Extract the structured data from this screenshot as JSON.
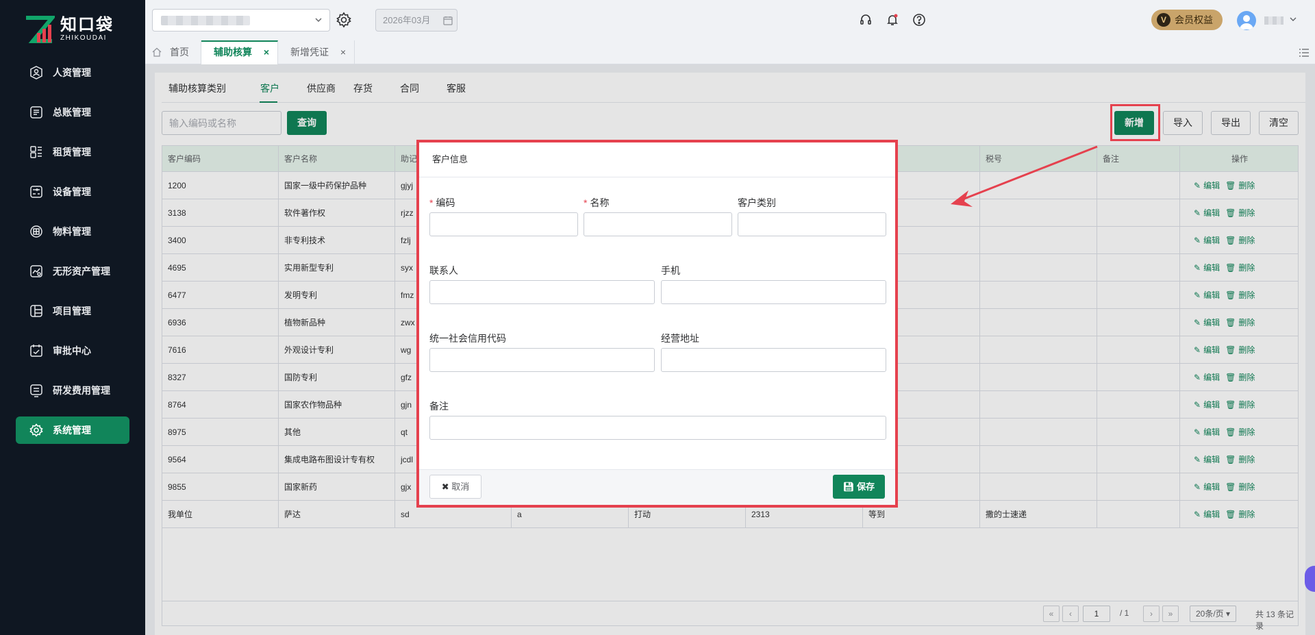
{
  "brand": {
    "name_cn": "知口袋",
    "name_en": "ZHIKOUDAI"
  },
  "colors": {
    "primary": "#11855a",
    "sidebar_bg": "#0f1722",
    "highlight": "#e5414e",
    "vip": "#c9a46a"
  },
  "sidebar": {
    "items": [
      {
        "label": "人资管理",
        "icon": "user-badge-icon"
      },
      {
        "label": "总账管理",
        "icon": "ledger-icon"
      },
      {
        "label": "租赁管理",
        "icon": "lease-icon"
      },
      {
        "label": "设备管理",
        "icon": "device-icon"
      },
      {
        "label": "物料管理",
        "icon": "material-icon"
      },
      {
        "label": "无形资产管理",
        "icon": "asset-chart-icon"
      },
      {
        "label": "项目管理",
        "icon": "project-icon"
      },
      {
        "label": "审批中心",
        "icon": "approval-icon"
      },
      {
        "label": "研发费用管理",
        "icon": "rnd-icon"
      },
      {
        "label": "系统管理",
        "icon": "gear-icon",
        "active": true
      }
    ]
  },
  "header": {
    "date": "2026年03月",
    "vip_badge": "V",
    "vip_label": "会员权益"
  },
  "tabs": [
    {
      "label": "首页"
    },
    {
      "label": "辅助核算",
      "active": true,
      "close": "×"
    },
    {
      "label": "新增凭证",
      "close": "×"
    }
  ],
  "subtabs": [
    "辅助核算类别",
    "客户",
    "供应商",
    "存货",
    "合同",
    "客服"
  ],
  "toolbar": {
    "search_placeholder": "输入编码或名称",
    "query_label": "查询",
    "add_label": "新增",
    "import_label": "导入",
    "export_label": "导出",
    "clear_label": "清空"
  },
  "table": {
    "columns": [
      "客户编码",
      "客户名称",
      "助记",
      "",
      "",
      "",
      "",
      "税号",
      "备注",
      "操作"
    ],
    "edit_label": "编辑",
    "delete_label": "删除",
    "rows": [
      {
        "code": "1200",
        "name": "国家一级中药保护品种",
        "mnemonic": "gjyj",
        "c4": "",
        "c5": "",
        "c6": "",
        "c7": "",
        "tax": "",
        "remark": ""
      },
      {
        "code": "3138",
        "name": "软件著作权",
        "mnemonic": "rjzz",
        "c4": "",
        "c5": "",
        "c6": "",
        "c7": "",
        "tax": "",
        "remark": ""
      },
      {
        "code": "3400",
        "name": "非专利技术",
        "mnemonic": "fzlj",
        "c4": "",
        "c5": "",
        "c6": "",
        "c7": "",
        "tax": "",
        "remark": ""
      },
      {
        "code": "4695",
        "name": "实用新型专利",
        "mnemonic": "syx",
        "c4": "",
        "c5": "",
        "c6": "",
        "c7": "",
        "tax": "",
        "remark": ""
      },
      {
        "code": "6477",
        "name": "发明专利",
        "mnemonic": "fmz",
        "c4": "",
        "c5": "",
        "c6": "",
        "c7": "",
        "tax": "",
        "remark": ""
      },
      {
        "code": "6936",
        "name": "植物新品种",
        "mnemonic": "zwx",
        "c4": "",
        "c5": "",
        "c6": "",
        "c7": "",
        "tax": "",
        "remark": ""
      },
      {
        "code": "7616",
        "name": "外观设计专利",
        "mnemonic": "wg",
        "c4": "",
        "c5": "",
        "c6": "",
        "c7": "",
        "tax": "",
        "remark": ""
      },
      {
        "code": "8327",
        "name": "国防专利",
        "mnemonic": "gfz",
        "c4": "",
        "c5": "",
        "c6": "",
        "c7": "",
        "tax": "",
        "remark": ""
      },
      {
        "code": "8764",
        "name": "国家农作物品种",
        "mnemonic": "gjn",
        "c4": "",
        "c5": "",
        "c6": "",
        "c7": "",
        "tax": "",
        "remark": ""
      },
      {
        "code": "8975",
        "name": "其他",
        "mnemonic": "qt",
        "c4": "",
        "c5": "",
        "c6": "",
        "c7": "",
        "tax": "",
        "remark": ""
      },
      {
        "code": "9564",
        "name": "集成电路布图设计专有权",
        "mnemonic": "jcdl",
        "c4": "",
        "c5": "",
        "c6": "",
        "c7": "",
        "tax": "",
        "remark": ""
      },
      {
        "code": "9855",
        "name": "国家新药",
        "mnemonic": "gjx",
        "c4": "",
        "c5": "",
        "c6": "",
        "c7": "",
        "tax": "",
        "remark": ""
      },
      {
        "code": "我单位",
        "name": "萨达",
        "mnemonic": "sd",
        "c4": "a",
        "c5": "打动",
        "c6": "2313",
        "c7": "等到",
        "tax": "撒的士速递",
        "remark": ""
      }
    ]
  },
  "pager": {
    "page": "1",
    "total_pages": "/ 1",
    "page_size": "20条/页",
    "total": "共 13 条记录"
  },
  "modal": {
    "title": "客户信息",
    "fields": {
      "code": "编码",
      "name": "名称",
      "category": "客户类别",
      "contact": "联系人",
      "mobile": "手机",
      "credit_code": "统一社会信用代码",
      "address": "经营地址",
      "remark": "备注"
    },
    "required_mark": "*",
    "cancel_label": "取消",
    "save_label": "保存"
  }
}
